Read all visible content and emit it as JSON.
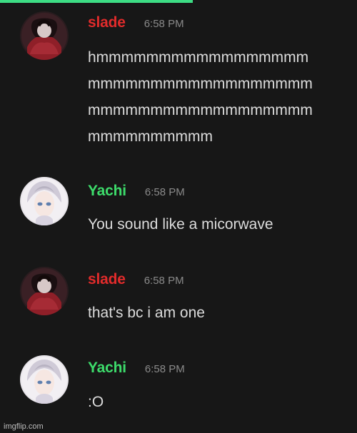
{
  "colors": {
    "background": "#171717",
    "accent_bar": "#3ddc84",
    "slade_name": "#e12b2b",
    "yachi_name": "#3ddc6b",
    "message_text": "#dcdcdc",
    "timestamp": "#8a8a8a"
  },
  "messages": [
    {
      "author": "slade",
      "time": "6:58 PM",
      "avatar": "red-dark-character-avatar",
      "lines": [
        "hmmmmmmmmmmmmmmmmm",
        "mmmmmmmmmmmmmmmmmm",
        "mmmmmmmmmmmmmmmmmm",
        "mmmmmmmmmm"
      ]
    },
    {
      "author": "Yachi",
      "time": "6:58 PM",
      "avatar": "white-haired-character-avatar",
      "lines": [
        "You sound like a micorwave"
      ]
    },
    {
      "author": "slade",
      "time": "6:58 PM",
      "avatar": "red-dark-character-avatar",
      "lines": [
        "that's bc i am one"
      ]
    },
    {
      "author": "Yachi",
      "time": "6:58 PM",
      "avatar": "white-haired-character-avatar",
      "lines": [
        ":O"
      ]
    }
  ],
  "footer": {
    "credit": "imgflip.com"
  }
}
